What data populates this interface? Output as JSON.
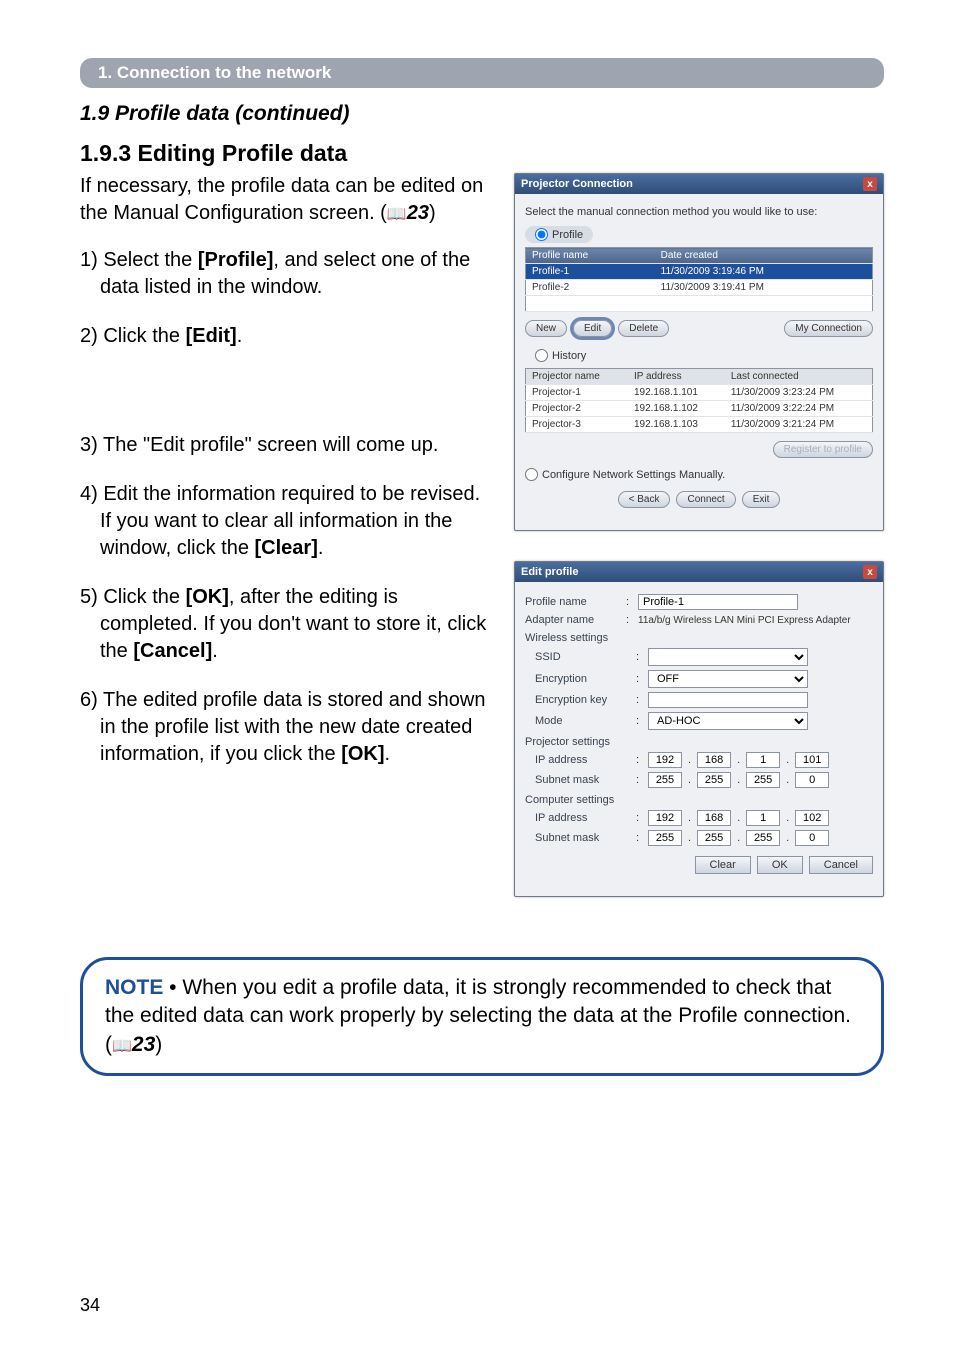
{
  "header": {
    "breadcrumb": "1. Connection to the network"
  },
  "titles": {
    "section": "1.9 Profile data (continued)",
    "subsection": "1.9.3 Editing Profile data"
  },
  "intro": {
    "line1": "If necessary, the profile data can be edited on the Manual Configuration screen. (",
    "ref": "23",
    "line2": ")"
  },
  "steps": {
    "s1a": "1) Select the ",
    "s1b": "[Profile]",
    "s1c": ", and select one of the data listed in the window.",
    "s2a": "2) Click the ",
    "s2b": "[Edit]",
    "s2c": ".",
    "s3": "3) The \"Edit profile\" screen will come up.",
    "s4a": "4) Edit the information required to be revised. If you want to clear all information in the window, click the ",
    "s4b": "[Clear]",
    "s4c": ".",
    "s5a": "5) Click the ",
    "s5b": "[OK]",
    "s5c": ", after the editing is completed. If you don't want to store it, click the ",
    "s5d": "[Cancel]",
    "s5e": ".",
    "s6a": "6) The edited profile data is stored and shown in the profile list with the new date created information, if you click the ",
    "s6b": "[OK]",
    "s6c": "."
  },
  "note": {
    "kw": "NOTE",
    "body1": " • When you edit a profile data, it is strongly recommended to check that the edited data can work properly by selecting the data at the Profile connection. (",
    "ref": "23",
    "body2": ")"
  },
  "pageNumber": "34",
  "dlg1": {
    "title": "Projector Connection",
    "instr": "Select the manual connection method you would like to use:",
    "radio_profile": "Profile",
    "th_name": "Profile name",
    "th_date": "Date created",
    "r1n": "Profile-1",
    "r1d": "11/30/2009 3:19:46 PM",
    "r2n": "Profile-2",
    "r2d": "11/30/2009 3:19:41 PM",
    "btn_new": "New",
    "btn_edit": "Edit",
    "btn_delete": "Delete",
    "btn_myconn": "My Connection",
    "radio_history": "History",
    "hth_name": "Projector name",
    "hth_ip": "IP address",
    "hth_last": "Last connected",
    "h1n": "Projector-1",
    "h1i": "192.168.1.101",
    "h1d": "11/30/2009 3:23:24 PM",
    "h2n": "Projector-2",
    "h2i": "192.168.1.102",
    "h2d": "11/30/2009 3:22:24 PM",
    "h3n": "Projector-3",
    "h3i": "192.168.1.103",
    "h3d": "11/30/2009 3:21:24 PM",
    "btn_register": "Register to profile",
    "radio_manual": "Configure Network Settings Manually.",
    "btn_back": "< Back",
    "btn_connect": "Connect",
    "btn_exit": "Exit"
  },
  "dlg2": {
    "title": "Edit profile",
    "lbl_profname": "Profile name",
    "val_profname": "Profile-1",
    "lbl_adapter": "Adapter name",
    "val_adapter": "11a/b/g Wireless LAN Mini PCI Express Adapter",
    "grp_wireless": "Wireless settings",
    "lbl_ssid": "SSID",
    "lbl_enc": "Encryption",
    "val_enc": "OFF",
    "lbl_enckey": "Encryption key",
    "lbl_mode": "Mode",
    "val_mode": "AD-HOC",
    "grp_proj": "Projector settings",
    "lbl_ip": "IP address",
    "pip1": "192",
    "pip2": "168",
    "pip3": "1",
    "pip4": "101",
    "lbl_mask": "Subnet mask",
    "pm1": "255",
    "pm2": "255",
    "pm3": "255",
    "pm4": "0",
    "grp_comp": "Computer settings",
    "cip1": "192",
    "cip2": "168",
    "cip3": "1",
    "cip4": "102",
    "cm1": "255",
    "cm2": "255",
    "cm3": "255",
    "cm4": "0",
    "btn_clear": "Clear",
    "btn_ok": "OK",
    "btn_cancel": "Cancel"
  }
}
